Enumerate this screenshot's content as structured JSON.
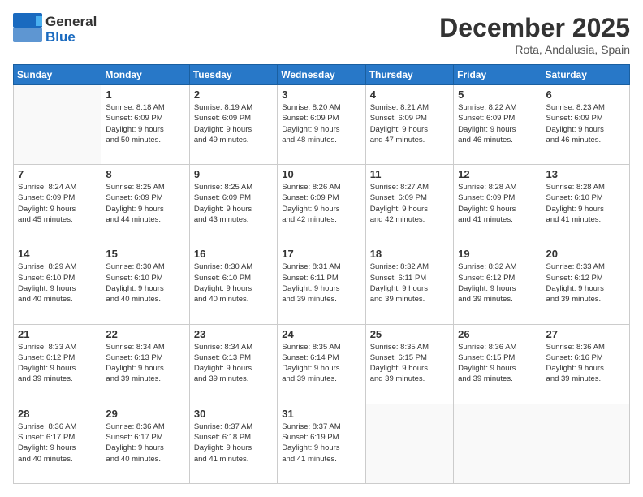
{
  "logo": {
    "line1": "General",
    "line2": "Blue"
  },
  "title": "December 2025",
  "location": "Rota, Andalusia, Spain",
  "weekdays": [
    "Sunday",
    "Monday",
    "Tuesday",
    "Wednesday",
    "Thursday",
    "Friday",
    "Saturday"
  ],
  "weeks": [
    [
      {
        "day": "",
        "info": ""
      },
      {
        "day": "1",
        "info": "Sunrise: 8:18 AM\nSunset: 6:09 PM\nDaylight: 9 hours\nand 50 minutes."
      },
      {
        "day": "2",
        "info": "Sunrise: 8:19 AM\nSunset: 6:09 PM\nDaylight: 9 hours\nand 49 minutes."
      },
      {
        "day": "3",
        "info": "Sunrise: 8:20 AM\nSunset: 6:09 PM\nDaylight: 9 hours\nand 48 minutes."
      },
      {
        "day": "4",
        "info": "Sunrise: 8:21 AM\nSunset: 6:09 PM\nDaylight: 9 hours\nand 47 minutes."
      },
      {
        "day": "5",
        "info": "Sunrise: 8:22 AM\nSunset: 6:09 PM\nDaylight: 9 hours\nand 46 minutes."
      },
      {
        "day": "6",
        "info": "Sunrise: 8:23 AM\nSunset: 6:09 PM\nDaylight: 9 hours\nand 46 minutes."
      }
    ],
    [
      {
        "day": "7",
        "info": "Sunrise: 8:24 AM\nSunset: 6:09 PM\nDaylight: 9 hours\nand 45 minutes."
      },
      {
        "day": "8",
        "info": "Sunrise: 8:25 AM\nSunset: 6:09 PM\nDaylight: 9 hours\nand 44 minutes."
      },
      {
        "day": "9",
        "info": "Sunrise: 8:25 AM\nSunset: 6:09 PM\nDaylight: 9 hours\nand 43 minutes."
      },
      {
        "day": "10",
        "info": "Sunrise: 8:26 AM\nSunset: 6:09 PM\nDaylight: 9 hours\nand 42 minutes."
      },
      {
        "day": "11",
        "info": "Sunrise: 8:27 AM\nSunset: 6:09 PM\nDaylight: 9 hours\nand 42 minutes."
      },
      {
        "day": "12",
        "info": "Sunrise: 8:28 AM\nSunset: 6:09 PM\nDaylight: 9 hours\nand 41 minutes."
      },
      {
        "day": "13",
        "info": "Sunrise: 8:28 AM\nSunset: 6:10 PM\nDaylight: 9 hours\nand 41 minutes."
      }
    ],
    [
      {
        "day": "14",
        "info": "Sunrise: 8:29 AM\nSunset: 6:10 PM\nDaylight: 9 hours\nand 40 minutes."
      },
      {
        "day": "15",
        "info": "Sunrise: 8:30 AM\nSunset: 6:10 PM\nDaylight: 9 hours\nand 40 minutes."
      },
      {
        "day": "16",
        "info": "Sunrise: 8:30 AM\nSunset: 6:10 PM\nDaylight: 9 hours\nand 40 minutes."
      },
      {
        "day": "17",
        "info": "Sunrise: 8:31 AM\nSunset: 6:11 PM\nDaylight: 9 hours\nand 39 minutes."
      },
      {
        "day": "18",
        "info": "Sunrise: 8:32 AM\nSunset: 6:11 PM\nDaylight: 9 hours\nand 39 minutes."
      },
      {
        "day": "19",
        "info": "Sunrise: 8:32 AM\nSunset: 6:12 PM\nDaylight: 9 hours\nand 39 minutes."
      },
      {
        "day": "20",
        "info": "Sunrise: 8:33 AM\nSunset: 6:12 PM\nDaylight: 9 hours\nand 39 minutes."
      }
    ],
    [
      {
        "day": "21",
        "info": "Sunrise: 8:33 AM\nSunset: 6:12 PM\nDaylight: 9 hours\nand 39 minutes."
      },
      {
        "day": "22",
        "info": "Sunrise: 8:34 AM\nSunset: 6:13 PM\nDaylight: 9 hours\nand 39 minutes."
      },
      {
        "day": "23",
        "info": "Sunrise: 8:34 AM\nSunset: 6:13 PM\nDaylight: 9 hours\nand 39 minutes."
      },
      {
        "day": "24",
        "info": "Sunrise: 8:35 AM\nSunset: 6:14 PM\nDaylight: 9 hours\nand 39 minutes."
      },
      {
        "day": "25",
        "info": "Sunrise: 8:35 AM\nSunset: 6:15 PM\nDaylight: 9 hours\nand 39 minutes."
      },
      {
        "day": "26",
        "info": "Sunrise: 8:36 AM\nSunset: 6:15 PM\nDaylight: 9 hours\nand 39 minutes."
      },
      {
        "day": "27",
        "info": "Sunrise: 8:36 AM\nSunset: 6:16 PM\nDaylight: 9 hours\nand 39 minutes."
      }
    ],
    [
      {
        "day": "28",
        "info": "Sunrise: 8:36 AM\nSunset: 6:17 PM\nDaylight: 9 hours\nand 40 minutes."
      },
      {
        "day": "29",
        "info": "Sunrise: 8:36 AM\nSunset: 6:17 PM\nDaylight: 9 hours\nand 40 minutes."
      },
      {
        "day": "30",
        "info": "Sunrise: 8:37 AM\nSunset: 6:18 PM\nDaylight: 9 hours\nand 41 minutes."
      },
      {
        "day": "31",
        "info": "Sunrise: 8:37 AM\nSunset: 6:19 PM\nDaylight: 9 hours\nand 41 minutes."
      },
      {
        "day": "",
        "info": ""
      },
      {
        "day": "",
        "info": ""
      },
      {
        "day": "",
        "info": ""
      }
    ]
  ]
}
